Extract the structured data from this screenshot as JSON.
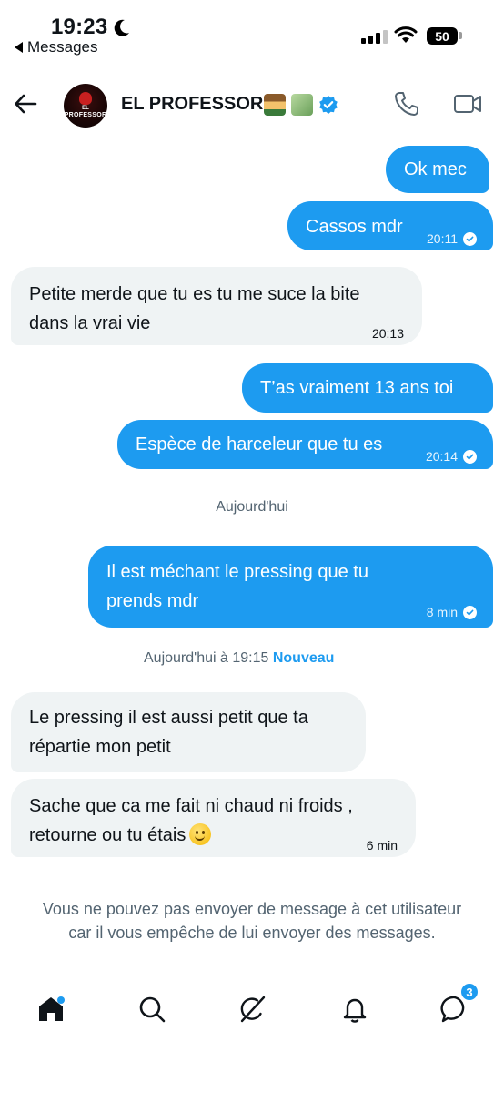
{
  "status_bar": {
    "time": "19:23",
    "back_app": "Messages",
    "battery": "50"
  },
  "header": {
    "avatar_text_line1": "EL",
    "avatar_text_line2": "PROFESSOR",
    "contact_name": "EL PROFESSOR",
    "emoji_1": "teacher-emoji",
    "emoji_2": "money-wings-emoji"
  },
  "messages": [
    {
      "dir": "out",
      "text": "Ok mec",
      "time": "",
      "read": false
    },
    {
      "dir": "out",
      "text": "Cassos mdr",
      "time": "20:11",
      "read": true
    },
    {
      "dir": "in",
      "text": "Petite merde que tu es tu me suce la bite dans la vrai vie",
      "time": "20:13"
    },
    {
      "dir": "out",
      "text": "T’as vraiment 13 ans toi",
      "time": "",
      "read": false
    },
    {
      "dir": "out",
      "text": "Espèce de harceleur que tu es",
      "time": "20:14",
      "read": true
    },
    {
      "dir": "out",
      "text": "Il est méchant le pressing que tu prends mdr",
      "time": "8 min",
      "read": true
    },
    {
      "dir": "in",
      "text": "Le pressing il est aussi petit que ta répartie mon petit",
      "time": ""
    },
    {
      "dir": "in",
      "text": "Sache que ca me fait ni chaud ni froids , retourne ou tu étais",
      "time": "6 min",
      "emoji": "slightly-smiling-face"
    }
  ],
  "separators": {
    "today": "Aujourd'hui",
    "new_prefix": "Aujourd'hui à 19:15",
    "new_label": "Nouveau"
  },
  "blocked_notice": "Vous ne pouvez pas envoyer de message à cet utilisateur car il vous empêche de lui envoyer des messages.",
  "bottom_nav": {
    "items": [
      "home-icon",
      "search-icon",
      "grok-icon",
      "notifications-icon",
      "messages-icon"
    ],
    "messages_badge": "3"
  },
  "colors": {
    "accent": "#1d9bf0",
    "incoming_bubble": "#eff3f4",
    "secondary_text": "#536471"
  }
}
